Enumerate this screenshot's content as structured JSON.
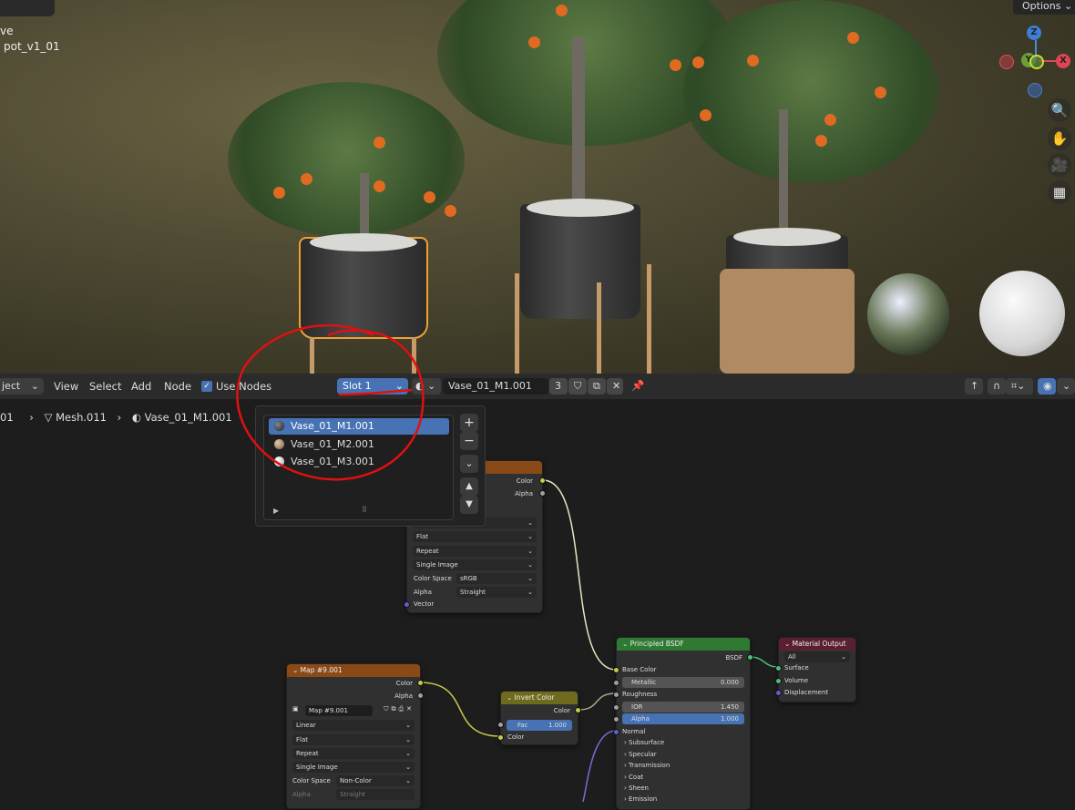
{
  "viewport": {
    "mode_partial": "ve",
    "object_name": "pot_v1_01",
    "options_label": "Options",
    "gizmo": {
      "z": "Z",
      "y": "Y",
      "x": "X"
    }
  },
  "header": {
    "mode_partial": "ject",
    "menus": [
      "View",
      "Select",
      "Add",
      "Node"
    ],
    "use_nodes_label": "Use Nodes",
    "use_nodes_checked": true,
    "slot_label": "Slot 1",
    "material_name": "Vase_01_M1.001",
    "user_count": "3"
  },
  "breadcrumb": {
    "object_partial": "01",
    "mesh": "Mesh.011",
    "material": "Vase_01_M1.001"
  },
  "slot_popup": {
    "items": [
      {
        "label": "Vase_01_M1.001",
        "selected": true,
        "color": "#2a2e36"
      },
      {
        "label": "Vase_01_M2.001",
        "selected": false,
        "color": "#a88a66"
      },
      {
        "label": "Vase_01_M3.001",
        "selected": false,
        "color": "#d8d8d8"
      }
    ]
  },
  "nodes": {
    "image_tex": {
      "out_color": "Color",
      "out_alpha": "Alpha",
      "extension": "Flat",
      "repeat": "Repeat",
      "source": "Single Image",
      "color_space_label": "Color Space",
      "color_space": "sRGB",
      "alpha_label": "Alpha",
      "alpha": "Straight",
      "vector": "Vector"
    },
    "map": {
      "title": "Map #9.001",
      "out_color": "Color",
      "out_alpha": "Alpha",
      "image": "Map #9.001",
      "interpolation": "Linear",
      "projection": "Flat",
      "extension": "Repeat",
      "source": "Single Image",
      "color_space_label": "Color Space",
      "color_space": "Non-Color",
      "alpha_label": "Alpha",
      "alpha": "Straight"
    },
    "invert": {
      "title": "Invert Color",
      "out_color": "Color",
      "fac_label": "Fac",
      "fac": "1.000",
      "in_color": "Color"
    },
    "bsdf": {
      "title": "Principled BSDF",
      "out": "BSDF",
      "base_color": "Base Color",
      "metallic_label": "Metallic",
      "metallic": "0.000",
      "roughness": "Roughness",
      "ior_label": "IOR",
      "ior": "1.450",
      "alpha_label": "Alpha",
      "alpha": "1.000",
      "normal": "Normal",
      "panels": [
        "Subsurface",
        "Specular",
        "Transmission",
        "Coat",
        "Sheen",
        "Emission"
      ]
    },
    "output": {
      "title": "Material Output",
      "target": "All",
      "surface": "Surface",
      "volume": "Volume",
      "displacement": "Displacement"
    }
  },
  "colors": {
    "accent": "#4772b3",
    "annotation": "#e01010",
    "tex_header": "#8a4a18",
    "bsdf_header": "#2f7a33",
    "output_header": "#5a2030",
    "invert_header": "#6e6a1e"
  }
}
